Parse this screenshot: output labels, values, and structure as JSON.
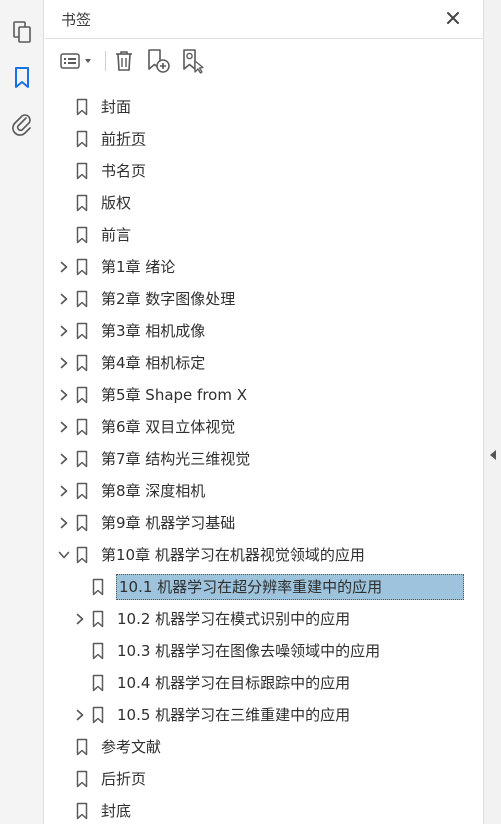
{
  "rail": {
    "items": [
      {
        "name": "pages-icon",
        "active": false
      },
      {
        "name": "bookmark-icon",
        "active": true
      },
      {
        "name": "attachment-icon",
        "active": false
      }
    ]
  },
  "panel": {
    "title": "书签",
    "close_icon": "close-icon"
  },
  "toolbar": {
    "options_icon": "options-menu-icon",
    "delete_icon": "delete-icon",
    "new_bookmark_icon": "new-bookmark-icon",
    "bookmark_settings_icon": "find-bookmark-icon"
  },
  "colors": {
    "accent": "#1473e6",
    "selection": "#9ec3dc",
    "icon": "#5a5a5a"
  },
  "bookmarks": [
    {
      "label": "封面",
      "level": 0,
      "toggle": "none"
    },
    {
      "label": "前折页",
      "level": 0,
      "toggle": "none",
      "underline": true
    },
    {
      "label": "书名页",
      "level": 0,
      "toggle": "none"
    },
    {
      "label": "版权",
      "level": 0,
      "toggle": "none"
    },
    {
      "label": "前言",
      "level": 0,
      "toggle": "none"
    },
    {
      "label": "第1章 绪论",
      "level": 0,
      "toggle": "collapsed"
    },
    {
      "label": "第2章 数字图像处理",
      "level": 0,
      "toggle": "collapsed"
    },
    {
      "label": "第3章 相机成像",
      "level": 0,
      "toggle": "collapsed"
    },
    {
      "label": "第4章 相机标定",
      "level": 0,
      "toggle": "collapsed"
    },
    {
      "label": "第5章 Shape from X",
      "level": 0,
      "toggle": "collapsed"
    },
    {
      "label": "第6章 双目立体视觉",
      "level": 0,
      "toggle": "collapsed"
    },
    {
      "label": "第7章 结构光三维视觉",
      "level": 0,
      "toggle": "collapsed"
    },
    {
      "label": "第8章 深度相机",
      "level": 0,
      "toggle": "collapsed"
    },
    {
      "label": "第9章 机器学习基础",
      "level": 0,
      "toggle": "collapsed"
    },
    {
      "label": "第10章 机器学习在机器视觉领域的应用",
      "level": 0,
      "toggle": "expanded"
    },
    {
      "label": "10.1 机器学习在超分辨率重建中的应用",
      "level": 1,
      "toggle": "none",
      "selected": true
    },
    {
      "label": "10.2 机器学习在模式识别中的应用",
      "level": 1,
      "toggle": "collapsed"
    },
    {
      "label": "10.3 机器学习在图像去噪领域中的应用",
      "level": 1,
      "toggle": "none"
    },
    {
      "label": "10.4 机器学习在目标跟踪中的应用",
      "level": 1,
      "toggle": "none"
    },
    {
      "label": "10.5 机器学习在三维重建中的应用",
      "level": 1,
      "toggle": "collapsed"
    },
    {
      "label": "参考文献",
      "level": 0,
      "toggle": "none"
    },
    {
      "label": "后折页",
      "level": 0,
      "toggle": "none"
    },
    {
      "label": "封底",
      "level": 0,
      "toggle": "none"
    }
  ],
  "collapse_panel_icon": "collapse-arrow-icon"
}
